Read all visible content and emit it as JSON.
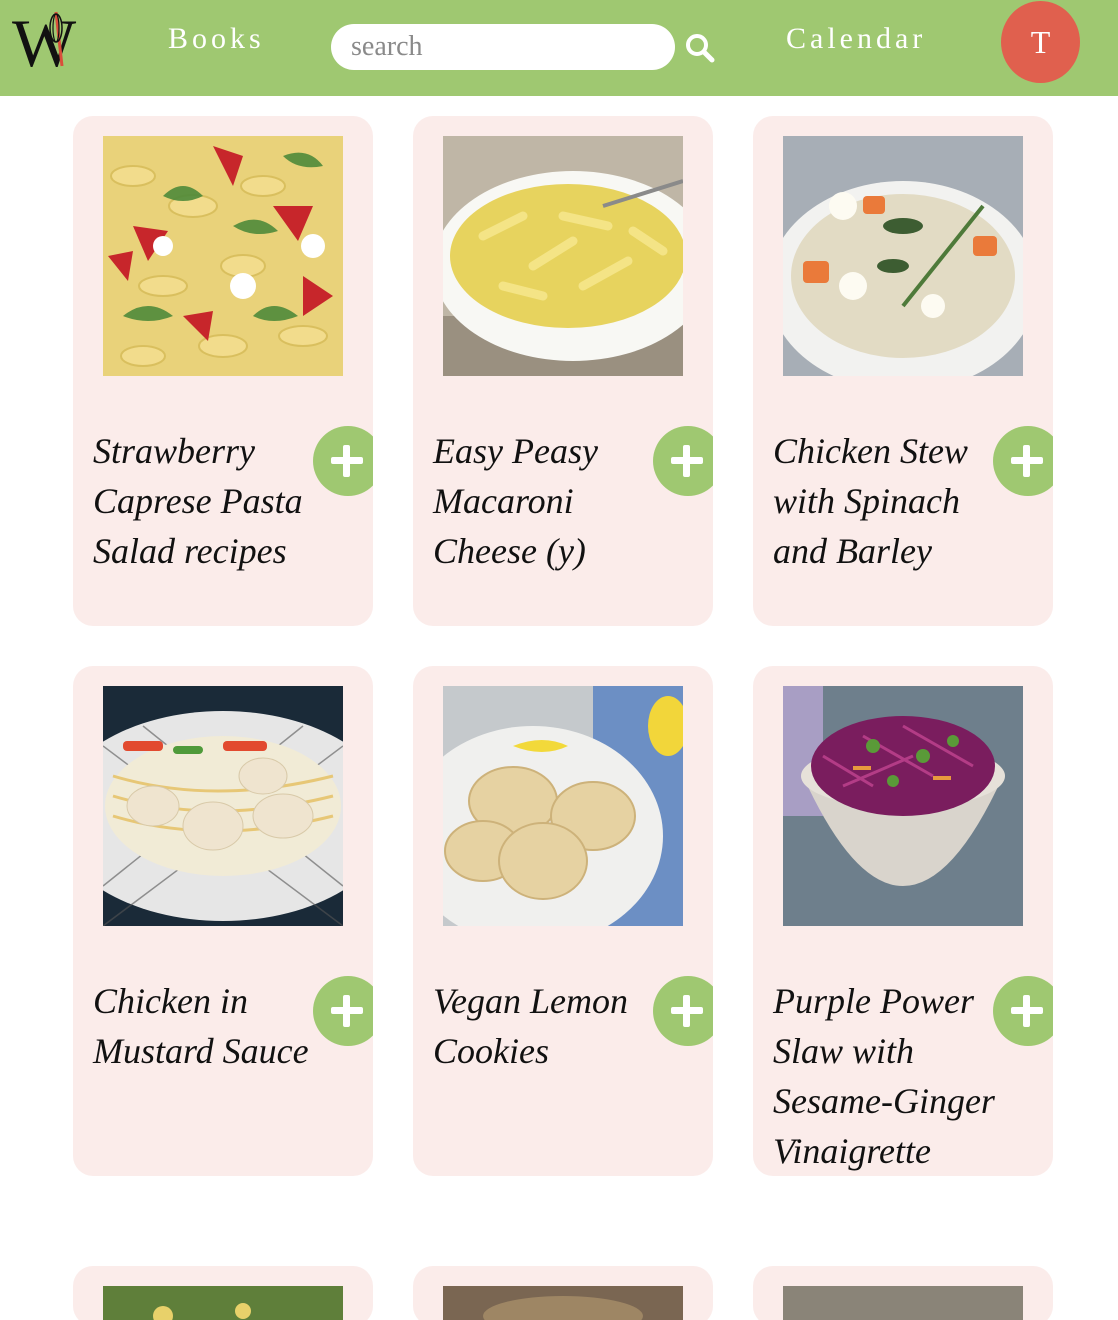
{
  "header": {
    "logo_letters": "W",
    "nav_books": "Books",
    "search_placeholder": "search",
    "nav_calendar": "Calendar",
    "avatar_initial": "T",
    "colors": {
      "bar": "#9fc871",
      "avatar": "#e0604e"
    }
  },
  "recipes": [
    {
      "title": "Strawberry Caprese Pasta Salad recipes",
      "image": "pasta-salad-photo"
    },
    {
      "title": "Easy Peasy Macaroni Cheese (y)",
      "image": "mac-and-cheese-photo"
    },
    {
      "title": "Chicken Stew with Spinach and Barley",
      "image": "chicken-stew-photo"
    },
    {
      "title": "Chicken in Mustard Sauce",
      "image": "chicken-mustard-photo"
    },
    {
      "title": "Vegan Lemon Cookies",
      "image": "lemon-cookies-photo"
    },
    {
      "title": "Purple Power Slaw with Sesame-Ginger Vinaigrette",
      "image": "purple-slaw-photo"
    }
  ],
  "card_background": "#fbecea",
  "add_button_color": "#9fc871"
}
